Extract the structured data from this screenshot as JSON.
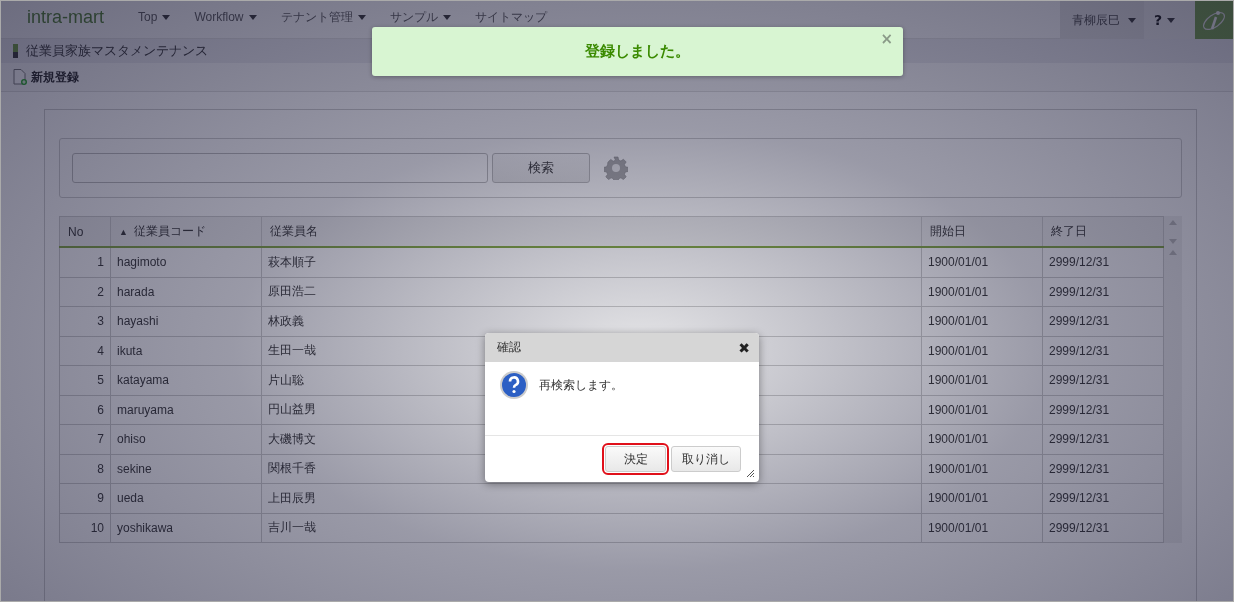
{
  "nav": {
    "logo": "intra-mart",
    "menus": [
      {
        "label": "Top",
        "dropdown": true
      },
      {
        "label": "Workflow",
        "dropdown": true
      },
      {
        "label": "テナント管理",
        "dropdown": true
      },
      {
        "label": "サンプル",
        "dropdown": true
      },
      {
        "label": "サイトマップ",
        "dropdown": false
      }
    ],
    "user": "青柳辰巳",
    "help": "?"
  },
  "page_title": "従業員家族マスタメンテナンス",
  "toolbar": {
    "new_label": "新規登録"
  },
  "search": {
    "button": "検索"
  },
  "table": {
    "columns": [
      {
        "label": "No"
      },
      {
        "label": "従業員コード",
        "sort": "▲"
      },
      {
        "label": "従業員名"
      },
      {
        "label": "開始日"
      },
      {
        "label": "終了日"
      }
    ],
    "rows": [
      [
        "1",
        "hagimoto",
        "萩本順子",
        "1900/01/01",
        "2999/12/31"
      ],
      [
        "2",
        "harada",
        "原田浩二",
        "1900/01/01",
        "2999/12/31"
      ],
      [
        "3",
        "hayashi",
        "林政義",
        "1900/01/01",
        "2999/12/31"
      ],
      [
        "4",
        "ikuta",
        "生田一哉",
        "1900/01/01",
        "2999/12/31"
      ],
      [
        "5",
        "katayama",
        "片山聡",
        "1900/01/01",
        "2999/12/31"
      ],
      [
        "6",
        "maruyama",
        "円山益男",
        "1900/01/01",
        "2999/12/31"
      ],
      [
        "7",
        "ohiso",
        "大磯博文",
        "1900/01/01",
        "2999/12/31"
      ],
      [
        "8",
        "sekine",
        "関根千香",
        "1900/01/01",
        "2999/12/31"
      ],
      [
        "9",
        "ueda",
        "上田辰男",
        "1900/01/01",
        "2999/12/31"
      ],
      [
        "10",
        "yoshikawa",
        "吉川一哉",
        "1900/01/01",
        "2999/12/31"
      ]
    ]
  },
  "toast": {
    "message": "登録しました。",
    "close": "×"
  },
  "dialog": {
    "title": "確認",
    "close": "✖",
    "message": "再検索します。",
    "buttons": [
      {
        "label": "決定",
        "highlighted": true
      },
      {
        "label": "取り消し",
        "highlighted": false
      }
    ]
  }
}
